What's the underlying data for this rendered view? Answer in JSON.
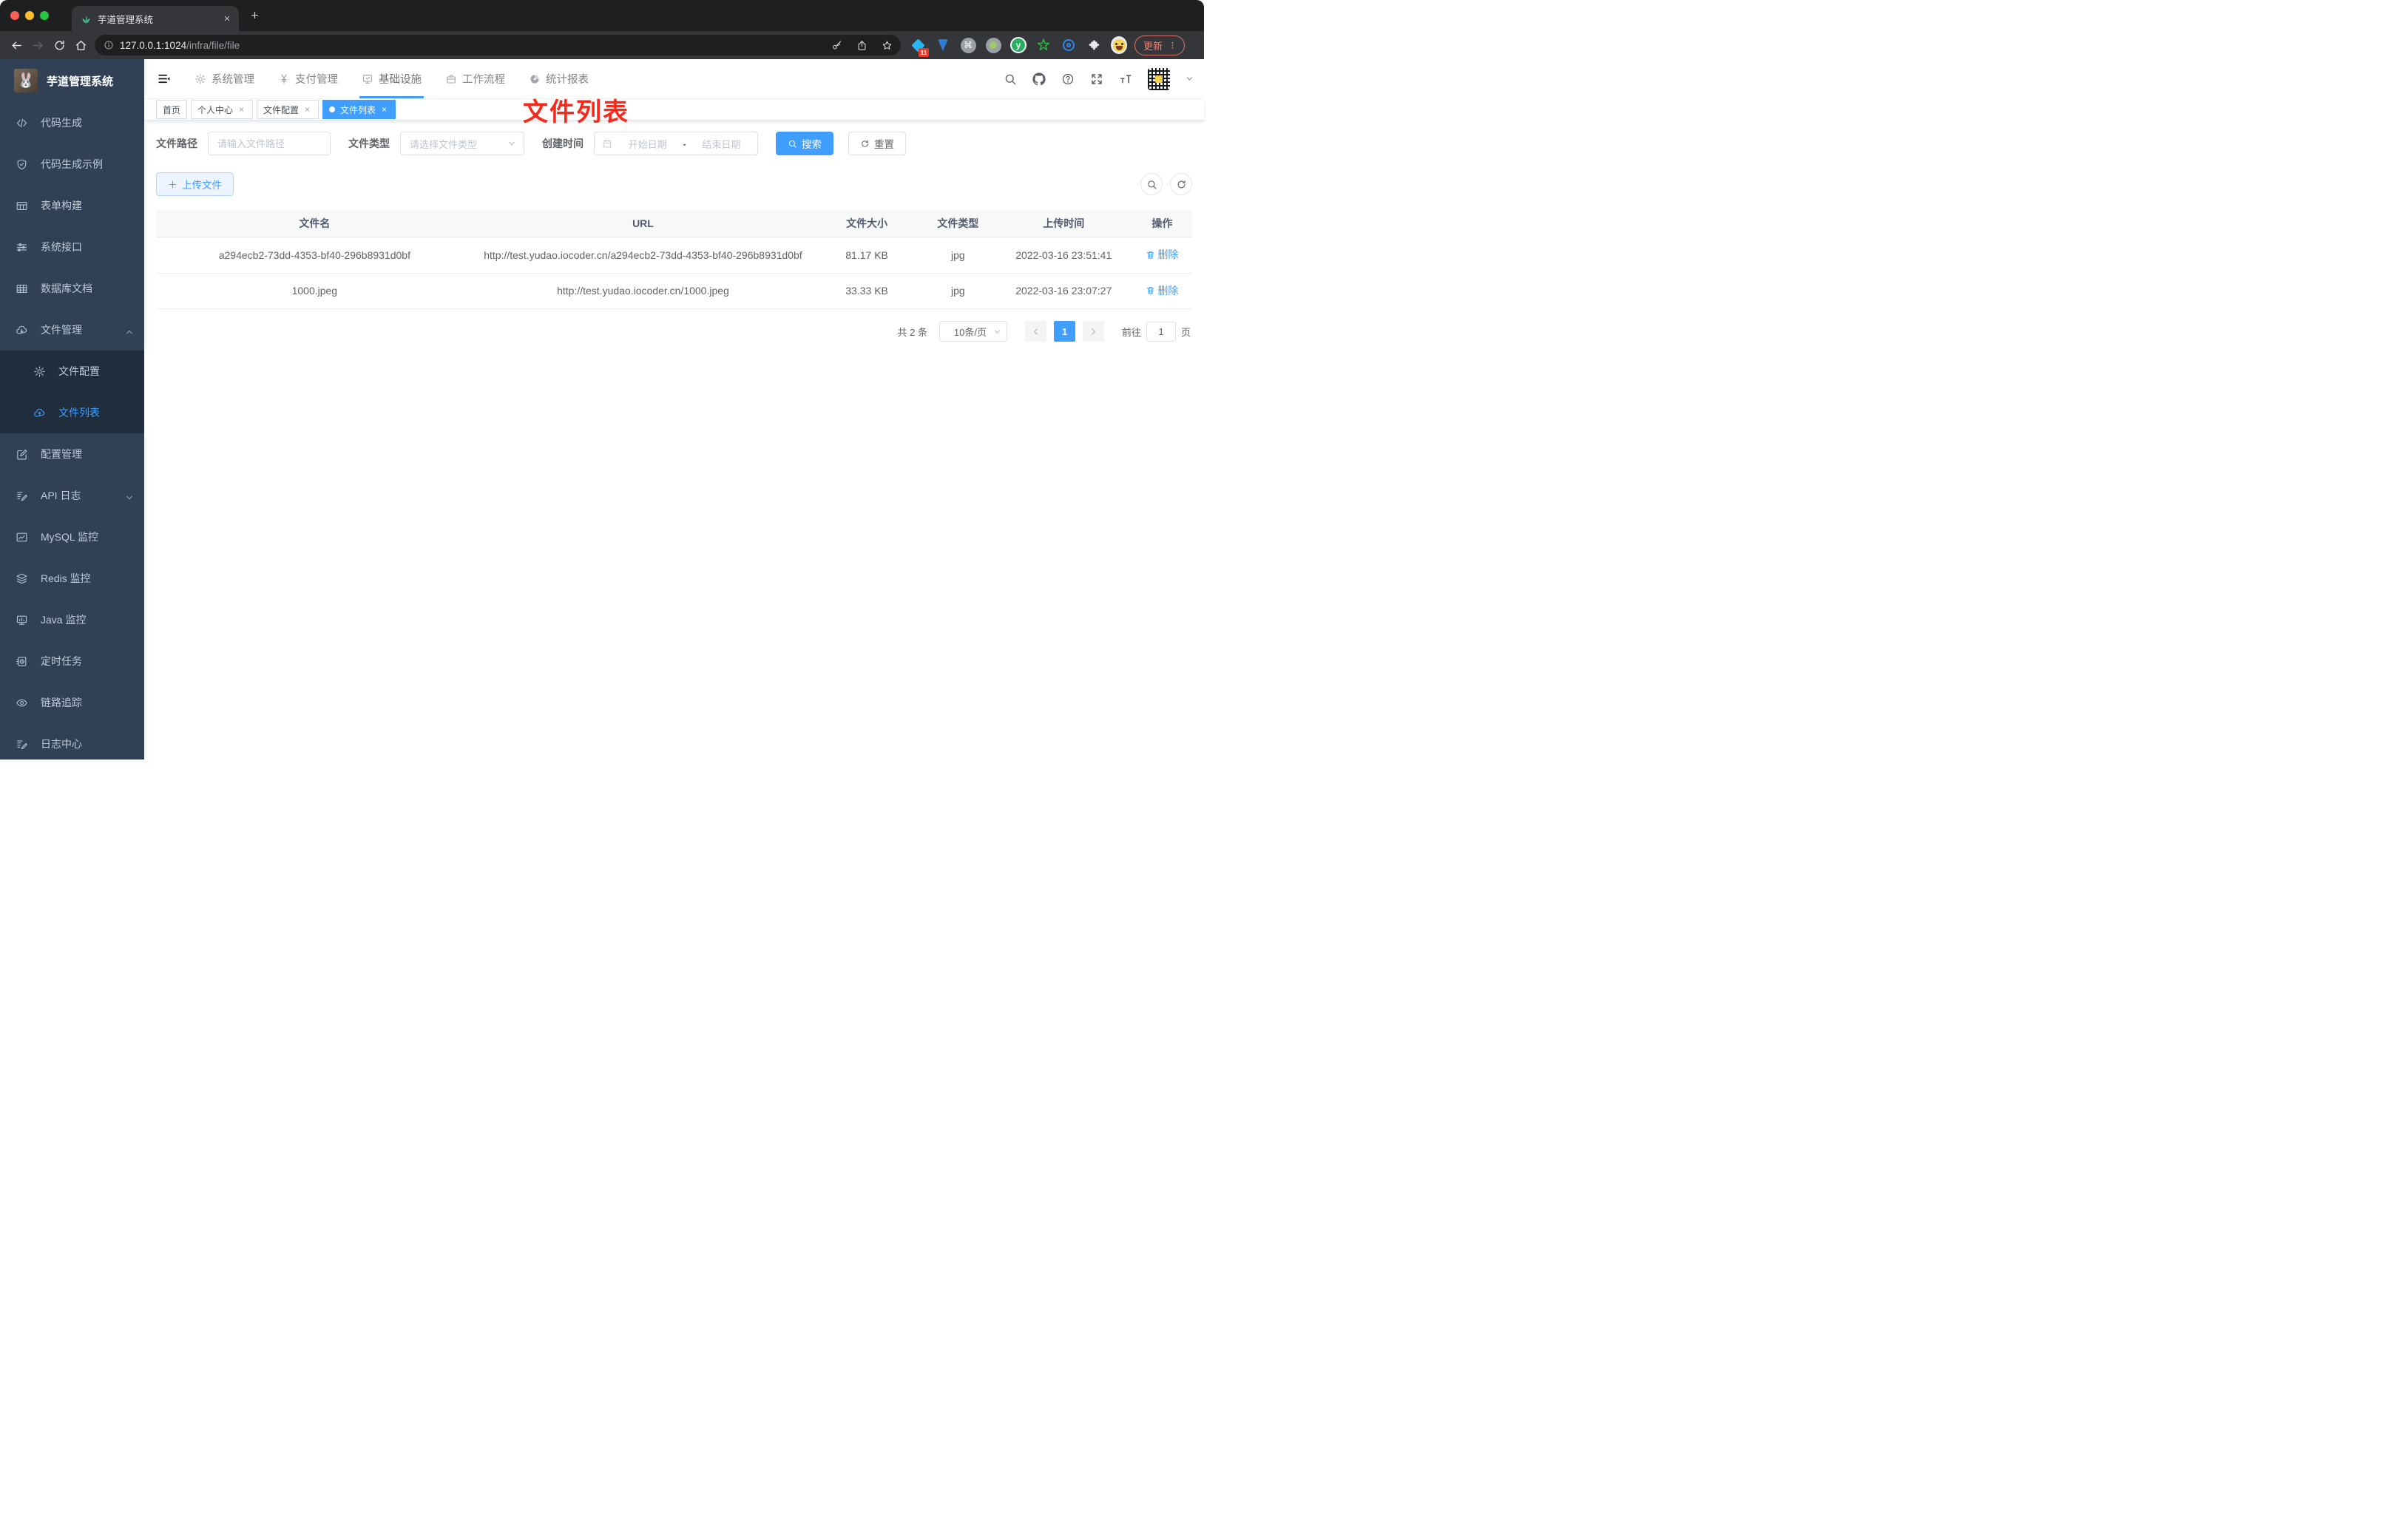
{
  "browser": {
    "tab_title": "芋道管理系统",
    "url_host": "127.0.0.1:1024",
    "url_path": "/infra/file/file",
    "update_label": "更新",
    "extensions": {
      "badge": "11",
      "cmd_glyph": "⌘",
      "y_glyph": "y"
    }
  },
  "sidebar": {
    "logo_title": "芋道管理系统",
    "logo_emoji": "🐰",
    "items": [
      {
        "label": "代码生成",
        "icon": "code"
      },
      {
        "label": "代码生成示例",
        "icon": "shield"
      },
      {
        "label": "表单构建",
        "icon": "form"
      },
      {
        "label": "系统接口",
        "icon": "sliders"
      },
      {
        "label": "数据库文档",
        "icon": "grid"
      },
      {
        "label": "文件管理",
        "icon": "cloud-down",
        "expanded": true,
        "children": [
          {
            "label": "文件配置",
            "icon": "gear"
          },
          {
            "label": "文件列表",
            "icon": "cloud-up",
            "active": true
          }
        ]
      },
      {
        "label": "配置管理",
        "icon": "pencil-square"
      },
      {
        "label": "API 日志",
        "icon": "note-edit",
        "collapsible": true
      },
      {
        "label": "MySQL 监控",
        "icon": "chart"
      },
      {
        "label": "Redis 监控",
        "icon": "layers"
      },
      {
        "label": "Java 监控",
        "icon": "monitor"
      },
      {
        "label": "定时任务",
        "icon": "timer"
      },
      {
        "label": "链路追踪",
        "icon": "eye"
      },
      {
        "label": "日志中心",
        "icon": "note-edit"
      }
    ]
  },
  "header": {
    "nav": [
      {
        "label": "系统管理",
        "icon": "gear"
      },
      {
        "label": "支付管理",
        "icon": "yen"
      },
      {
        "label": "基础设施",
        "icon": "monitor-check",
        "active": true
      },
      {
        "label": "工作流程",
        "icon": "briefcase"
      },
      {
        "label": "统计报表",
        "icon": "dashboard"
      }
    ]
  },
  "tags": [
    {
      "label": "首页",
      "closable": false
    },
    {
      "label": "个人中心",
      "closable": true
    },
    {
      "label": "文件配置",
      "closable": true
    },
    {
      "label": "文件列表",
      "closable": true,
      "active": true
    }
  ],
  "annotation": {
    "text": "文件列表",
    "color": "#f8291a"
  },
  "filters": {
    "path_label": "文件路径",
    "path_placeholder": "请输入文件路径",
    "type_label": "文件类型",
    "type_placeholder": "请选择文件类型",
    "date_label": "创建时间",
    "date_start_placeholder": "开始日期",
    "date_separator": "-",
    "date_end_placeholder": "结束日期",
    "search_label": "搜索",
    "reset_label": "重置"
  },
  "toolbar": {
    "upload_label": "上传文件"
  },
  "table": {
    "columns": [
      "文件名",
      "URL",
      "文件大小",
      "文件类型",
      "上传时间",
      "操作"
    ],
    "rows": [
      {
        "name": "a294ecb2-73dd-4353-bf40-296b8931d0bf",
        "url": "http://test.yudao.iocoder.cn/a294ecb2-73dd-4353-bf40-296b8931d0bf",
        "size": "81.17 KB",
        "type": "jpg",
        "time": "2022-03-16 23:51:41",
        "action": "删除"
      },
      {
        "name": "1000.jpeg",
        "url": "http://test.yudao.iocoder.cn/1000.jpeg",
        "size": "33.33 KB",
        "type": "jpg",
        "time": "2022-03-16 23:07:27",
        "action": "删除"
      }
    ]
  },
  "pagination": {
    "total": "共 2 条",
    "page_size": "10条/页",
    "pages": [
      "1"
    ],
    "current_page": "1",
    "goto_label": "前往",
    "goto_value": "1",
    "page_unit": "页"
  },
  "colors": {
    "accent": "#409eff",
    "sidebar_bg": "#304156",
    "submenu_bg": "#1f2d3d",
    "sidebar_text": "#bfcbd9",
    "annotation_red": "#f8291a",
    "upload_bg": "#ecf5ff"
  }
}
